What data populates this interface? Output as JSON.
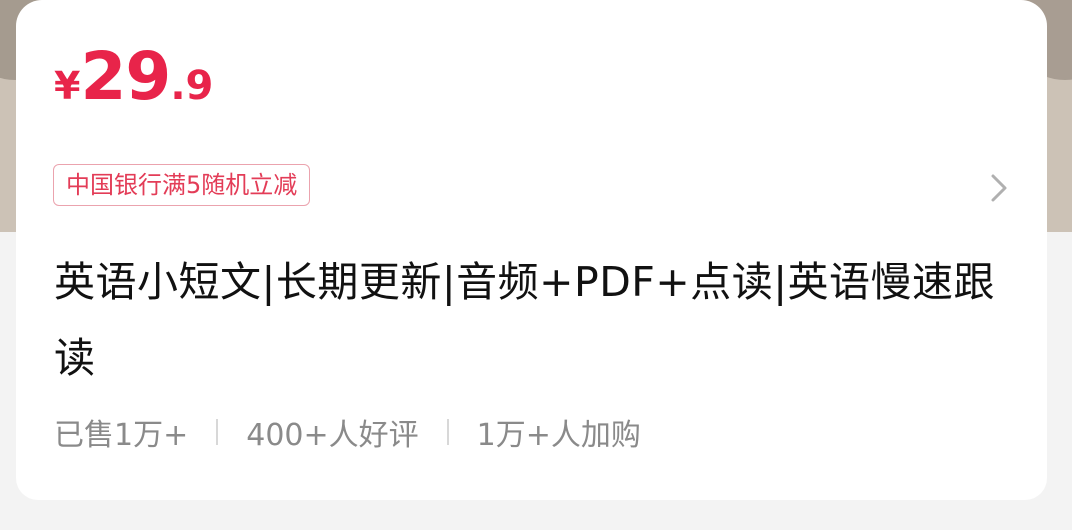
{
  "price": {
    "currency_symbol": "¥",
    "integer": "29",
    "decimal": ".9",
    "color": "#e8244a"
  },
  "promo": {
    "label": "中国银行满5随机立减"
  },
  "product": {
    "title": "英语小短文|长期更新|音频+PDF+点读|英语慢速跟读"
  },
  "stats": {
    "sold": "已售1万+",
    "reviews": "400+人好评",
    "add_to_cart": "1万+人加购"
  },
  "icons": {
    "chevron": "chevron-right-icon"
  }
}
